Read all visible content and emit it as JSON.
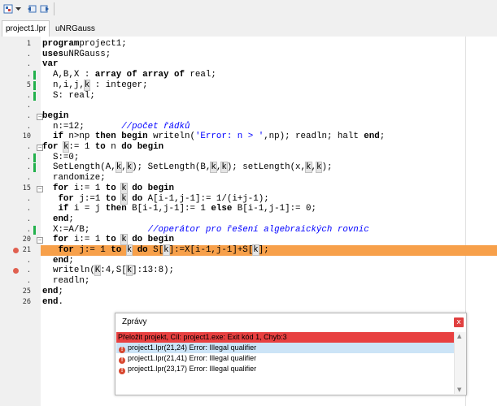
{
  "toolbar": {
    "icons": [
      "component-icon",
      "dropdown-arrow-icon",
      "back-icon",
      "forward-icon"
    ]
  },
  "tabs": [
    {
      "label": "project1.lpr"
    },
    {
      "label": "uNRGauss"
    }
  ],
  "editor": {
    "lines": [
      {
        "num": "1",
        "tokens": [
          [
            "kw",
            "program"
          ],
          [
            "",
            "project1;"
          ]
        ]
      },
      {
        "num": ".",
        "tokens": [
          [
            "kw",
            "uses"
          ],
          [
            "",
            "uNRGauss;"
          ]
        ]
      },
      {
        "num": ".",
        "tokens": [
          [
            "kw",
            "var"
          ]
        ]
      },
      {
        "num": ".",
        "green": true,
        "tokens": [
          [
            "",
            "  A,B,X : "
          ],
          [
            "kw",
            "array of array of"
          ],
          [
            "",
            " real;"
          ]
        ]
      },
      {
        "num": "5",
        "green": true,
        "tokens": [
          [
            "",
            "  n,i,j,"
          ],
          [
            "hl",
            "k"
          ],
          [
            "",
            " : integer;"
          ]
        ]
      },
      {
        "num": ".",
        "green": true,
        "tokens": [
          [
            "",
            "  S: real;"
          ]
        ]
      },
      {
        "num": ".",
        "tokens": []
      },
      {
        "num": ".",
        "fold": true,
        "tokens": [
          [
            "kw",
            "begin"
          ]
        ]
      },
      {
        "num": ".",
        "tokens": [
          [
            "",
            "  n:=12;       "
          ],
          [
            "cmt",
            "//počet řádků"
          ]
        ]
      },
      {
        "num": "10",
        "tokens": [
          [
            "",
            "  "
          ],
          [
            "kw",
            "if"
          ],
          [
            "",
            " n>np "
          ],
          [
            "kw",
            "then begin"
          ],
          [
            "",
            " writeln("
          ],
          [
            "str",
            "'Error: n > '"
          ],
          [
            ",np); readln; halt "
          ],
          [
            "kw",
            "end"
          ],
          [
            ";"
          ]
        ]
      },
      {
        "num": ".",
        "fold": true,
        "tokens": [
          [
            "kw",
            "for"
          ],
          [
            " "
          ],
          [
            "hl",
            "k"
          ],
          [
            ":= 1 "
          ],
          [
            "kw",
            "to"
          ],
          [
            " n "
          ],
          [
            "kw",
            "do begin"
          ]
        ]
      },
      {
        "num": ".",
        "green": true,
        "tokens": [
          [
            "",
            "  S:=0;"
          ]
        ]
      },
      {
        "num": ".",
        "green": true,
        "tokens": [
          [
            "",
            "  SetLength(A,"
          ],
          [
            "hl",
            "k"
          ],
          [
            ","
          ],
          [
            "hl",
            "k"
          ],
          [
            "); SetLength(B,"
          ],
          [
            "hl",
            "k"
          ],
          [
            ","
          ],
          [
            "hl",
            "k"
          ],
          [
            "); setLength(x,"
          ],
          [
            "hl",
            "k"
          ],
          [
            ","
          ],
          [
            "hl",
            "k"
          ],
          [
            ");"
          ]
        ]
      },
      {
        "num": ".",
        "tokens": [
          [
            "",
            "  randomize;"
          ]
        ]
      },
      {
        "num": "15",
        "fold": true,
        "tokens": [
          [
            "",
            "  "
          ],
          [
            "kw",
            "for"
          ],
          [
            " i:= 1 "
          ],
          [
            "kw",
            "to"
          ],
          [
            " "
          ],
          [
            "hl",
            "k"
          ],
          [
            " "
          ],
          [
            "kw",
            "do begin"
          ]
        ]
      },
      {
        "num": ".",
        "tokens": [
          [
            "",
            "   "
          ],
          [
            "kw",
            "for"
          ],
          [
            " j:=1 "
          ],
          [
            "kw",
            "to"
          ],
          [
            " "
          ],
          [
            "hl",
            "k"
          ],
          [
            " "
          ],
          [
            "kw",
            "do"
          ],
          [
            " A[i-1,j-1]:= 1/(i+j-1);"
          ]
        ]
      },
      {
        "num": ".",
        "tokens": [
          [
            "",
            "   "
          ],
          [
            "kw",
            "if"
          ],
          [
            " i = j "
          ],
          [
            "kw",
            "then"
          ],
          [
            " B[i-1,j-1]:= 1 "
          ],
          [
            "kw",
            "else"
          ],
          [
            " B[i-1,j-1]:= 0;"
          ]
        ]
      },
      {
        "num": ".",
        "tokens": [
          [
            "",
            "  "
          ],
          [
            "kw",
            "end"
          ],
          [
            ";"
          ]
        ]
      },
      {
        "num": ".",
        "green": true,
        "tokens": [
          [
            "",
            "  X:=A/B;           "
          ],
          [
            "cmt",
            "//operátor pro řešení algebraických rovnic"
          ]
        ]
      },
      {
        "num": "20",
        "fold": true,
        "tokens": [
          [
            "",
            "  "
          ],
          [
            "kw",
            "for"
          ],
          [
            " i:= 1 "
          ],
          [
            "kw",
            "to"
          ],
          [
            " "
          ],
          [
            "hl",
            "k"
          ],
          [
            " "
          ],
          [
            "kw",
            "do begin"
          ]
        ]
      },
      {
        "num": "21",
        "error": true,
        "highlight": true,
        "tokens": [
          [
            "",
            "   "
          ],
          [
            "kw",
            "for"
          ],
          [
            " j:= 1 "
          ],
          [
            "kw",
            "to"
          ],
          [
            " "
          ],
          [
            "hl",
            "k"
          ],
          [
            " "
          ],
          [
            "kw",
            "do"
          ],
          [
            " S["
          ],
          [
            "hl",
            "k"
          ],
          [
            "]:=X[i-1,j-1]+S["
          ],
          [
            "hl",
            "k"
          ],
          [
            "];"
          ]
        ]
      },
      {
        "num": ".",
        "tokens": [
          [
            "",
            "  "
          ],
          [
            "kw",
            "end"
          ],
          [
            ";"
          ]
        ]
      },
      {
        "num": ".",
        "error": true,
        "tokens": [
          [
            "",
            "  writeln("
          ],
          [
            "hl",
            "K"
          ],
          [
            ":4,S["
          ],
          [
            "hl",
            "k"
          ],
          [
            "]:13:8);"
          ]
        ]
      },
      {
        "num": ".",
        "tokens": [
          [
            "",
            "  readln;"
          ]
        ]
      },
      {
        "num": "25",
        "tokens": [
          [
            "kw",
            "end"
          ],
          [
            ";"
          ]
        ]
      },
      {
        "num": "26",
        "tokens": [
          [
            "kw",
            "end"
          ],
          [
            "."
          ]
        ]
      }
    ]
  },
  "messages": {
    "title": "Zprávy",
    "close": "x",
    "summary": "Přeložit projekt, Cíl: project1.exe: Exit kód 1, Chyb:3",
    "errors": [
      {
        "text": "project1.lpr(21,24) Error: Illegal qualifier"
      },
      {
        "text": "project1.lpr(21,41) Error: Illegal qualifier"
      },
      {
        "text": "project1.lpr(23,17) Error: Illegal qualifier"
      }
    ]
  },
  "colors": {
    "error_line": "#f7a04a",
    "error_summary": "#e84040",
    "modified_marker": "#22b14c"
  }
}
